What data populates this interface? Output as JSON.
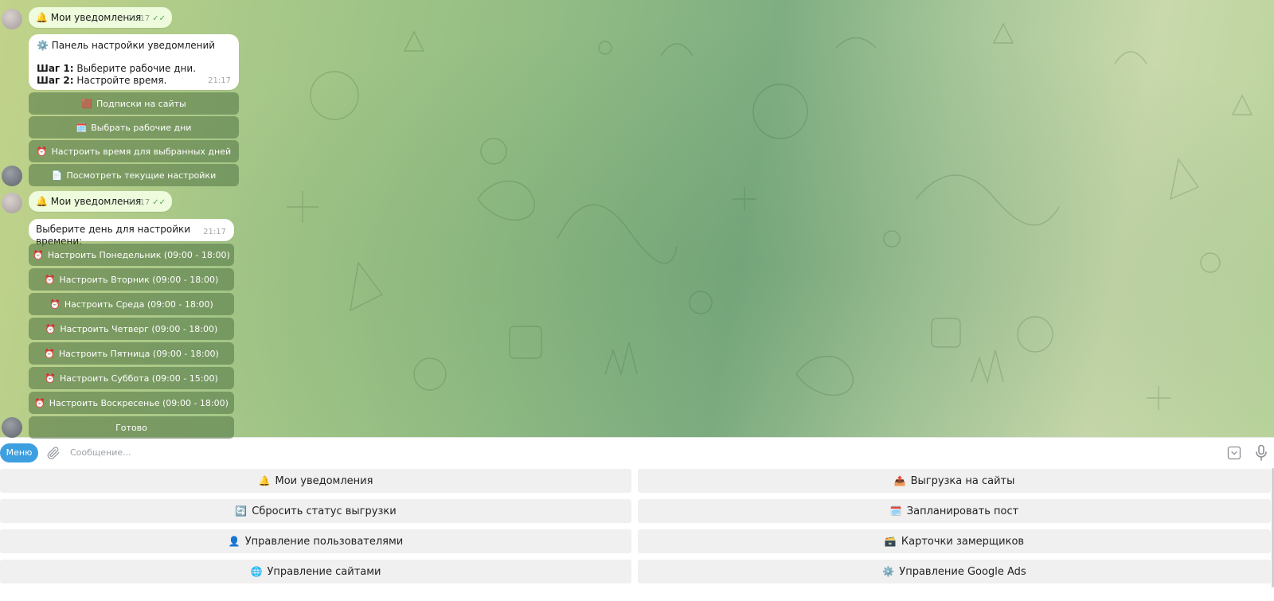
{
  "chat": {
    "messages": [
      {
        "type": "outgoing",
        "icon": "🔔",
        "text": "Мои уведомления",
        "time": "21:17"
      },
      {
        "type": "incoming",
        "icon": "⚙️",
        "title": "Панель настройки уведомлений",
        "step1_label": "Шаг 1:",
        "step1_text": "Выберите рабочие дни.",
        "step2_label": "Шаг 2:",
        "step2_text": "Настройте время.",
        "time": "21:17",
        "buttons": [
          {
            "icon": "🟫",
            "label": "Подписки на сайты"
          },
          {
            "icon": "🗓️",
            "label": "Выбрать рабочие дни"
          },
          {
            "icon": "⏰",
            "label": "Настроить время для выбранных дней"
          },
          {
            "icon": "📄",
            "label": "Посмотреть текущие настройки"
          }
        ]
      },
      {
        "type": "outgoing",
        "icon": "🔔",
        "text": "Мои уведомления",
        "time": "21:17"
      },
      {
        "type": "incoming",
        "text": "Выберите день для настройки времени:",
        "time": "21:17",
        "buttons": [
          {
            "icon": "⏰",
            "label": "Настроить Понедельник (09:00 - 18:00)"
          },
          {
            "icon": "⏰",
            "label": "Настроить Вторник (09:00 - 18:00)"
          },
          {
            "icon": "⏰",
            "label": "Настроить Среда (09:00 - 18:00)"
          },
          {
            "icon": "⏰",
            "label": "Настроить Четверг (09:00 - 18:00)"
          },
          {
            "icon": "⏰",
            "label": "Настроить Пятница (09:00 - 18:00)"
          },
          {
            "icon": "⏰",
            "label": "Настроить Суббота (09:00 - 15:00)"
          },
          {
            "icon": "⏰",
            "label": "Настроить Воскресенье (09:00 - 18:00)"
          },
          {
            "icon": "",
            "label": "Готово"
          }
        ]
      }
    ]
  },
  "composer": {
    "menu_label": "Меню",
    "placeholder": "Сообщение...",
    "attach_icon": "paperclip-icon",
    "keyboard_icon": "keyboard-toggle-icon",
    "mic_icon": "microphone-icon"
  },
  "reply_keyboard": {
    "buttons": [
      {
        "icon": "🔔",
        "label": "Мои уведомления"
      },
      {
        "icon": "📤",
        "label": "Выгрузка на сайты"
      },
      {
        "icon": "🔄",
        "label": "Сбросить статус выгрузки"
      },
      {
        "icon": "🗓️",
        "label": "Запланировать пост"
      },
      {
        "icon": "👤",
        "label": "Управление пользователями"
      },
      {
        "icon": "🗃️",
        "label": "Карточки замерщиков"
      },
      {
        "icon": "🌐",
        "label": "Управление сайтами"
      },
      {
        "icon": "⚙️",
        "label": "Управление Google Ads"
      }
    ]
  },
  "colors": {
    "menu_button": "#3d9fe0",
    "inline_button": "#5a7d4b",
    "outgoing_bubble": "#eefbdc",
    "reply_button": "#f0f0f0"
  }
}
